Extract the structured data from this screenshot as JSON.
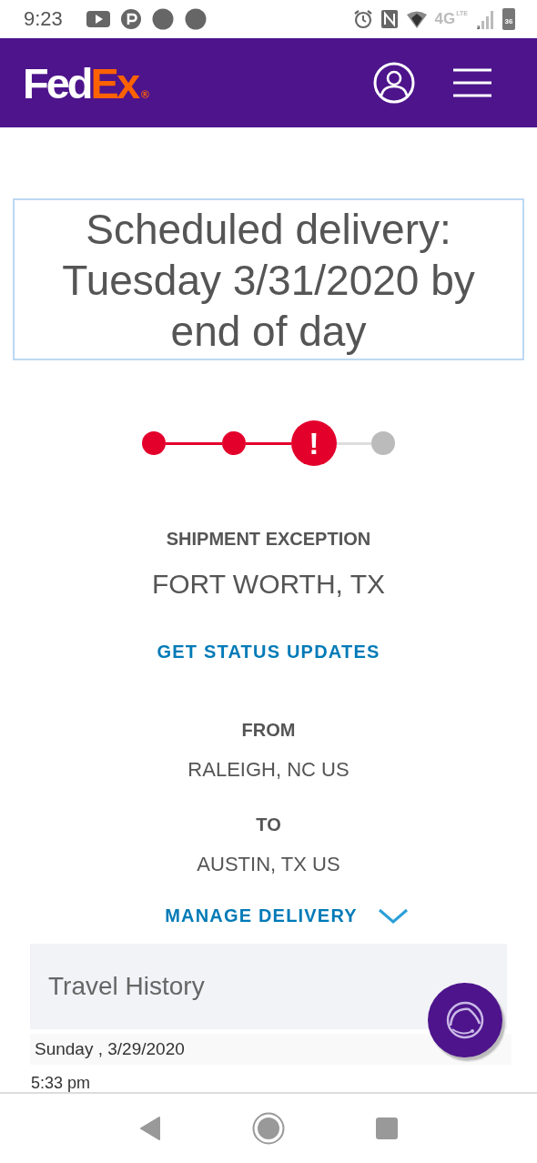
{
  "status_bar": {
    "time": "9:23",
    "network": "4G",
    "network_sub": "LTE",
    "battery": "36"
  },
  "header": {
    "logo": {
      "first": "Fed",
      "second": "Ex",
      "mark": "®"
    }
  },
  "delivery": {
    "heading": "Scheduled delivery: Tuesday 3/31/2020 by end of day"
  },
  "progress": [
    {
      "kind": "done"
    },
    {
      "kind": "done"
    },
    {
      "kind": "exception",
      "symbol": "!"
    },
    {
      "kind": "pending"
    }
  ],
  "status": {
    "label": "SHIPMENT EXCEPTION",
    "location": "FORT WORTH, TX",
    "link": "GET STATUS UPDATES"
  },
  "route": {
    "from_label": "FROM",
    "from": "RALEIGH, NC US",
    "to_label": "TO",
    "to": "AUSTIN, TX US"
  },
  "manage": {
    "label": "MANAGE DELIVERY",
    "expanded": false
  },
  "travel_history": {
    "title": "Travel History",
    "date": "Sunday , 3/29/2020",
    "time": "5:33 pm"
  }
}
